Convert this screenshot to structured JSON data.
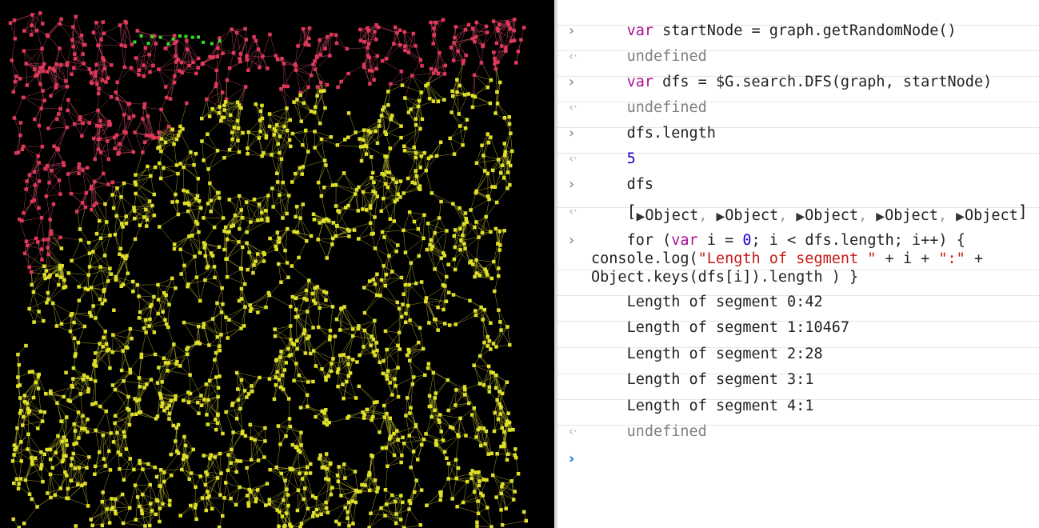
{
  "console": {
    "entries": [
      {
        "type": "input",
        "code": "var startNode = graph.getRandomNode()"
      },
      {
        "type": "result",
        "text": "undefined"
      },
      {
        "type": "input",
        "code": "var dfs = $G.search.DFS(graph, startNode)"
      },
      {
        "type": "result",
        "text": "undefined"
      },
      {
        "type": "input",
        "code": "dfs.length"
      },
      {
        "type": "result",
        "text": "5"
      },
      {
        "type": "input",
        "code": "dfs"
      },
      {
        "type": "result",
        "objects": [
          "Object",
          "Object",
          "Object",
          "Object",
          "Object"
        ]
      },
      {
        "type": "input",
        "code": "for (var i = 0; i < dfs.length; i++) { console.log(\"Length of segment \" + i + \":\" + Object.keys(dfs[i]).length ) }"
      },
      {
        "type": "log",
        "text": "Length of segment 0:42"
      },
      {
        "type": "log",
        "text": "Length of segment 1:10467"
      },
      {
        "type": "log",
        "text": "Length of segment 2:28"
      },
      {
        "type": "log",
        "text": "Length of segment 3:1"
      },
      {
        "type": "log",
        "text": "Length of segment 4:1"
      },
      {
        "type": "result",
        "text": "undefined"
      }
    ],
    "input_line": {
      "l1_a": "for (",
      "l1_kw": "var",
      "l1_b": " i = ",
      "l1_num": "0",
      "l1_c": "; i < dfs.length; i++) {",
      "l2_a": "console.log(",
      "l2_s1": "\"Length of segment \"",
      "l2_b": " + i + ",
      "l2_s2": "\":\"",
      "l2_c": " +",
      "l3": "Object.keys(dfs[i]).length ) }"
    }
  },
  "graph": {
    "colors": {
      "background": "#000000",
      "red_nodes": "#e0385a",
      "yellow_nodes": "#e0e028",
      "green_nodes": "#33dd22",
      "edges_red": "#c94a62",
      "edges_yellow": "#b8b830"
    }
  }
}
